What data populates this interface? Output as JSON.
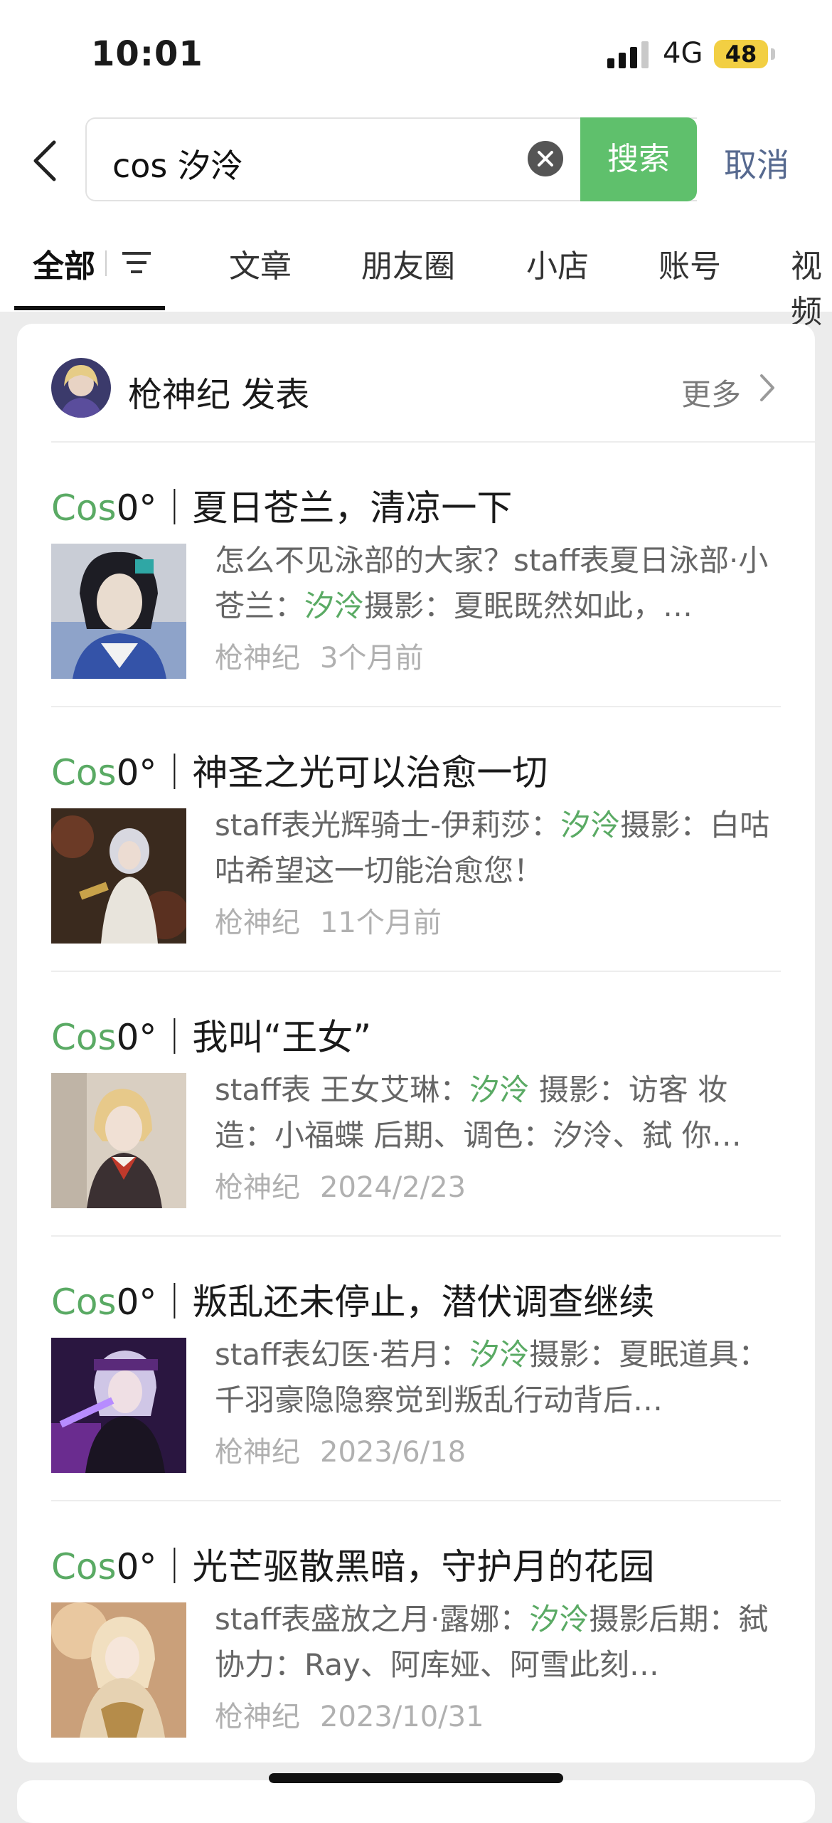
{
  "status_bar": {
    "time": "10:01",
    "network": "4G",
    "battery": "48"
  },
  "search": {
    "query": "cos 汐泠",
    "button_label": "搜索",
    "cancel_label": "取消"
  },
  "tabs": [
    {
      "label": "全部"
    },
    {
      "label": "文章"
    },
    {
      "label": "朋友圈"
    },
    {
      "label": "小店"
    },
    {
      "label": "账号"
    },
    {
      "label": "视频"
    }
  ],
  "publisher": {
    "name": "枪神纪 发表",
    "more_label": "更多"
  },
  "articles": [
    {
      "title_prefix": "Cos",
      "title_rest": "0°｜夏日苍兰，清凉一下",
      "desc_before": "怎么不见泳部的大家？staff表夏日泳部·小苍兰：",
      "desc_highlight": "汐泠",
      "desc_after": "摄影：夏眠既然如此，…",
      "author": "枪神纪",
      "time": "3个月前"
    },
    {
      "title_prefix": "Cos",
      "title_rest": "0°｜神圣之光可以治愈一切",
      "desc_before": "staff表光辉骑士-伊莉莎：",
      "desc_highlight": "汐泠",
      "desc_after": "摄影：白咕咕希望这一切能治愈您！",
      "author": "枪神纪",
      "time": "11个月前"
    },
    {
      "title_prefix": "Cos",
      "title_rest": "0°｜我叫“王女”",
      "desc_before": "staff表 王女艾琳：",
      "desc_highlight": "汐泠",
      "desc_after": " 摄影：访客 妆造：小福蝶 后期、调色：汐泠、弑 你…",
      "author": "枪神纪",
      "time": "2024/2/23"
    },
    {
      "title_prefix": "Cos",
      "title_rest": "0°｜叛乱还未停止，潜伏调查继续",
      "desc_before": "staff表幻医·若月：",
      "desc_highlight": "汐泠",
      "desc_after": "摄影：夏眠道具：千羽豪隐隐察觉到叛乱行动背后…",
      "author": "枪神纪",
      "time": "2023/6/18"
    },
    {
      "title_prefix": "Cos",
      "title_rest": "0°｜光芒驱散黑暗，守护月的花园",
      "desc_before": "staff表盛放之月·露娜：",
      "desc_highlight": "汐泠",
      "desc_after": "摄影后期：弑协力：Ray、阿库娅、阿雪此刻…",
      "author": "枪神纪",
      "time": "2023/10/31"
    }
  ],
  "colors": {
    "accent_green": "#5fc06c",
    "highlight_green": "#5aaa64",
    "link_blue": "#56698f"
  }
}
